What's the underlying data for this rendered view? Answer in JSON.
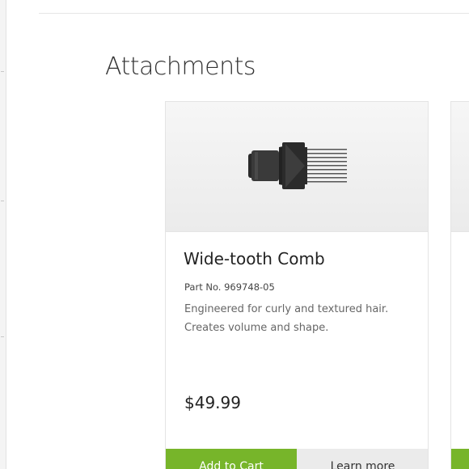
{
  "section": {
    "title": "Attachments"
  },
  "product": {
    "name": "Wide-tooth Comb",
    "part_number": "Part No. 969748-05",
    "description": "Engineered for curly and textured hair. Creates volume and shape.",
    "price": "$49.99",
    "image_icon": "wide-tooth-comb-attachment",
    "add_to_cart_label": "Add to Cart",
    "more_label": "Learn more"
  },
  "colors": {
    "accent_green": "#77b52a",
    "text_dark": "#222222",
    "text_muted": "#666666"
  }
}
